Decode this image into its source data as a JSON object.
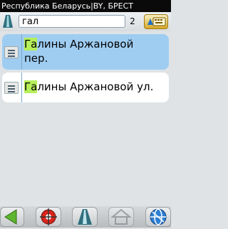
{
  "header": {
    "title": "Республика Беларусь|BY, БРЕСТ"
  },
  "search": {
    "value": "гал",
    "count": "2"
  },
  "results": [
    {
      "match": "Га",
      "rest_line1": "лины Аржановой",
      "rest_line2": "пер."
    },
    {
      "match": "Га",
      "rest_line1": "лины Аржановой ул."
    }
  ],
  "icons": {
    "search_type": "road-icon",
    "keyboard": "keyboard-icon",
    "row_item": "document-list-icon",
    "back": "back-arrow-icon",
    "compass": "compass-target-icon",
    "road": "road-icon",
    "home": "home-icon",
    "globe": "globe-icon"
  },
  "colors": {
    "selected_row": "#9fcdf2",
    "match_highlight": "#b5ef59",
    "titlebar": "#0a0a0a"
  }
}
